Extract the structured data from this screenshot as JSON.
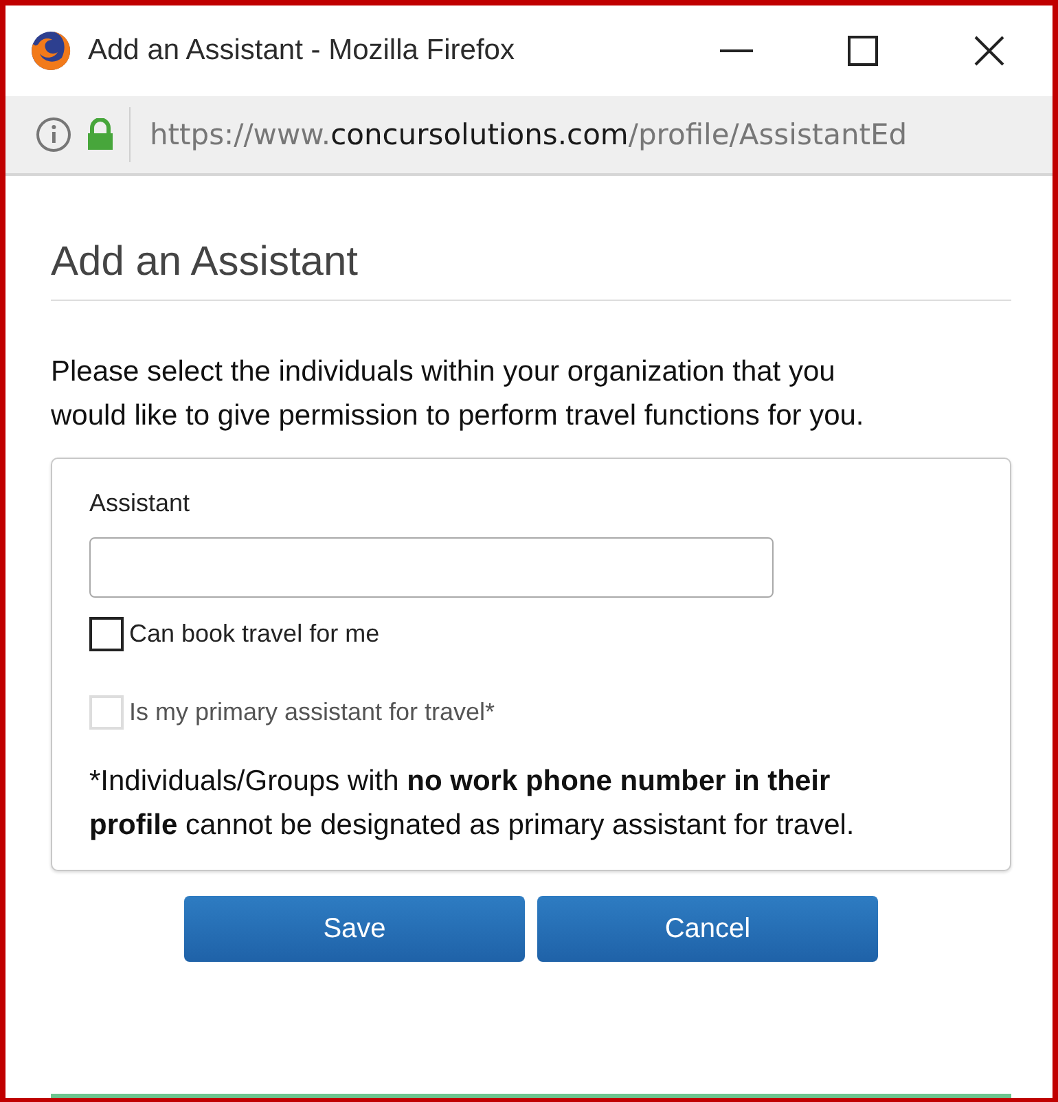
{
  "window": {
    "title": "Add an Assistant - Mozilla Firefox"
  },
  "address_bar": {
    "url_prefix": "https://www.",
    "url_domain": "concursolutions.com",
    "url_path": "/profile/AssistantEd"
  },
  "dialog": {
    "heading": "Add an Assistant",
    "intro": "Please select the individuals within your organization that you would like to give permission to perform travel functions for you.",
    "field": {
      "label": "Assistant"
    },
    "checkboxes": [
      {
        "label": "Can book travel for me",
        "checked": false,
        "disabled": false
      },
      {
        "label": "Is my primary assistant for travel*",
        "checked": false,
        "disabled": true
      }
    ],
    "note": "*Individuals/Groups with **no work phone number in their profile** cannot be designated as primary assistant for travel.",
    "buttons": [
      "Save",
      "Cancel"
    ]
  }
}
